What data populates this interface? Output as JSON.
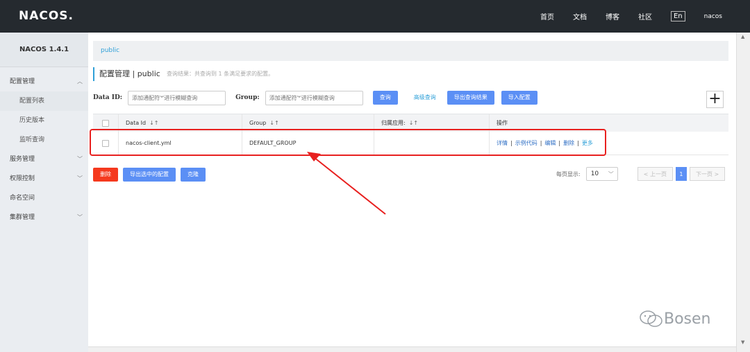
{
  "header": {
    "logo": "NACOS.",
    "nav": [
      "首页",
      "文档",
      "博客",
      "社区"
    ],
    "lang": "En",
    "user": "nacos"
  },
  "sidebar": {
    "title": "NACOS 1.4.1",
    "items": [
      {
        "label": "配置管理",
        "type": "group",
        "chevron": "up"
      },
      {
        "label": "配置列表",
        "type": "sub",
        "active": true
      },
      {
        "label": "历史版本",
        "type": "sub"
      },
      {
        "label": "监听查询",
        "type": "sub"
      },
      {
        "label": "服务管理",
        "type": "group",
        "chevron": "down"
      },
      {
        "label": "权限控制",
        "type": "group",
        "chevron": "down"
      },
      {
        "label": "命名空间",
        "type": "group"
      },
      {
        "label": "集群管理",
        "type": "group",
        "chevron": "down"
      }
    ]
  },
  "breadcrumb": "public",
  "page": {
    "title": "配置管理 | public",
    "hint": "查询结果：共查询到 1 条满足要求的配置。"
  },
  "filters": {
    "dataid_label": "Data ID:",
    "dataid_placeholder": "添加通配符'*'进行模糊查询",
    "group_label": "Group:",
    "group_placeholder": "添加通配符'*'进行模糊查询",
    "query": "查询",
    "advanced": "高级查询",
    "export_query": "导出查询结果",
    "import": "导入配置",
    "add": "+"
  },
  "table": {
    "columns": [
      "Data Id",
      "Group",
      "归属应用:",
      "操作"
    ],
    "sort_icon": "↓↑",
    "rows": [
      {
        "data_id": "nacos-client.yml",
        "group": "DEFAULT_GROUP",
        "app": "",
        "ops": [
          "详情",
          "示例代码",
          "编辑",
          "删除",
          "更多"
        ]
      }
    ],
    "op_separator": "|"
  },
  "bottom": {
    "delete": "删除",
    "export_selected": "导出选中的配置",
    "clone": "克隆"
  },
  "pager": {
    "label": "每页显示:",
    "size": "10",
    "prev": "< 上一页",
    "current": "1",
    "next": "下一页 >"
  },
  "watermark": "Bosen",
  "colors": {
    "topbar": "#252a2f",
    "primary": "#5b8ff5",
    "link": "#2fa0d8",
    "danger": "#f5391e",
    "annotation": "#e8201f"
  }
}
